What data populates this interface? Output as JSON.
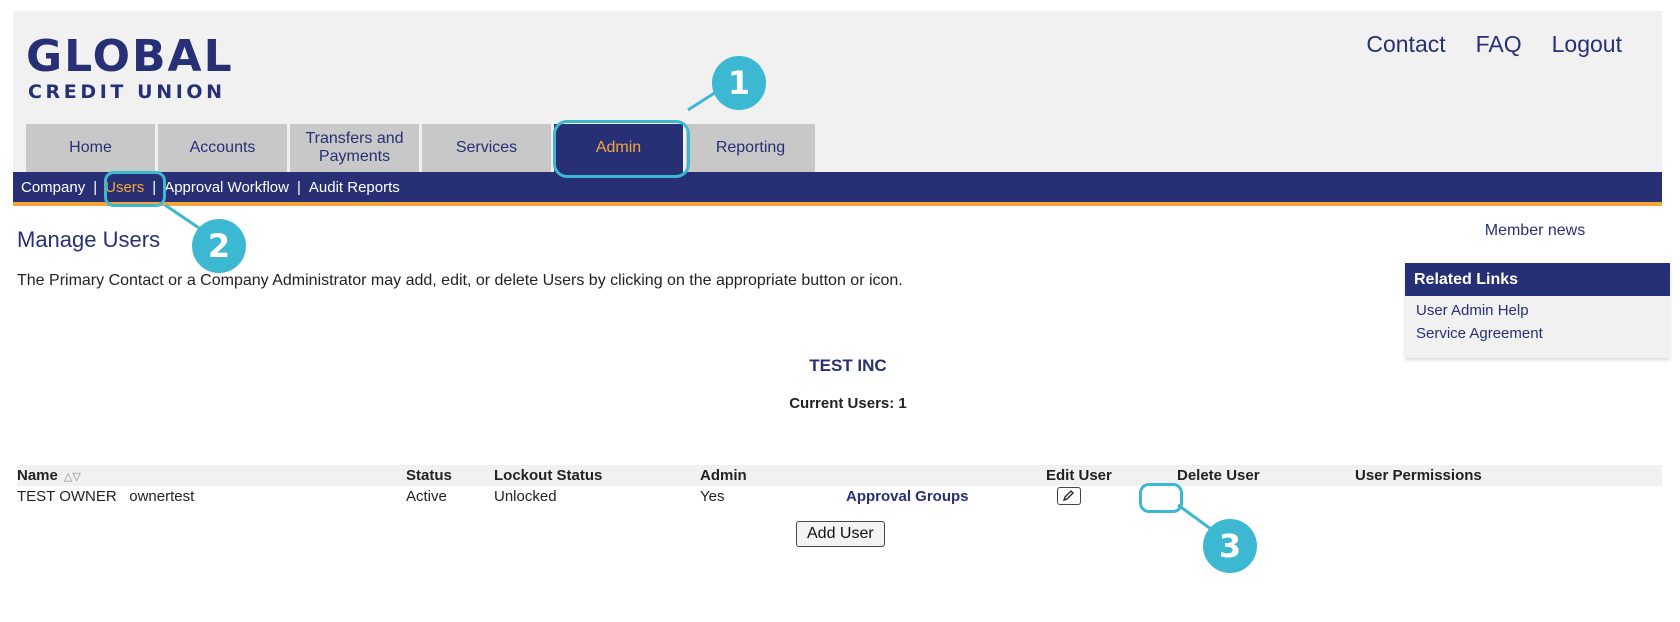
{
  "logo": {
    "main": "GLOBAL",
    "sub": "CREDIT UNION"
  },
  "top_links": [
    "Contact",
    "FAQ",
    "Logout"
  ],
  "tabs": [
    {
      "label": "Home"
    },
    {
      "label": "Accounts"
    },
    {
      "label": "Transfers and Payments"
    },
    {
      "label": "Services"
    },
    {
      "label": "Admin"
    },
    {
      "label": "Reporting"
    }
  ],
  "subnav": [
    "Company",
    "Users",
    "Approval Workflow",
    "Audit Reports"
  ],
  "page": {
    "title": "Manage Users",
    "intro": "The Primary Contact or a Company Administrator may add, edit, or delete Users by clicking on the appropriate button or icon.",
    "company": "TEST INC",
    "current_users_label": "Current Users:",
    "current_users_count": "1"
  },
  "table": {
    "headers": [
      "Name",
      "Status",
      "Lockout Status",
      "Admin",
      "",
      "Edit User",
      "Delete User",
      "User Permissions"
    ],
    "rows": [
      {
        "name": "TEST OWNER",
        "username": "ownertest",
        "status": "Active",
        "lockout": "Unlocked",
        "admin": "Yes",
        "groups_link": "Approval Groups"
      }
    ]
  },
  "add_user_label": "Add User",
  "sidebar": {
    "member_news": "Member news",
    "related_title": "Related Links",
    "links": [
      "User Admin Help",
      "Service Agreement"
    ]
  },
  "callouts": [
    "1",
    "2",
    "3"
  ],
  "colors": {
    "navy": "#273074",
    "orange": "#f4a63a",
    "callout": "#3cb8d3"
  }
}
